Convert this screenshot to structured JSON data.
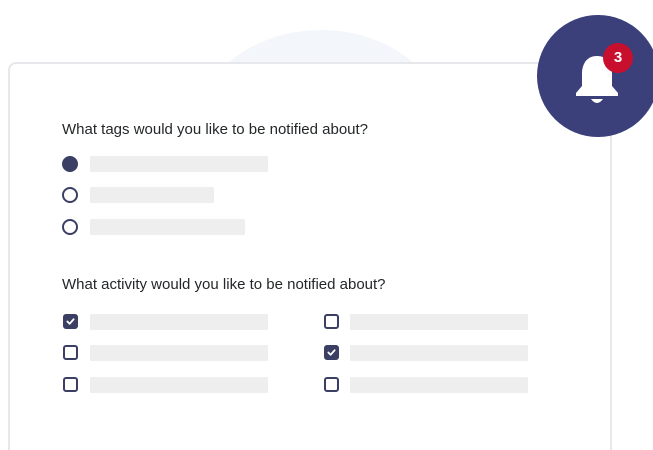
{
  "notifications": {
    "badge_count": "3",
    "icon": "bell-icon"
  },
  "tags_section": {
    "question": "What tags would you like to be notified about?",
    "options": [
      {
        "selected": true,
        "label": ""
      },
      {
        "selected": false,
        "label": ""
      },
      {
        "selected": false,
        "label": ""
      }
    ]
  },
  "activity_section": {
    "question": "What activity would you like to be notified about?",
    "options": [
      {
        "checked": true,
        "label": ""
      },
      {
        "checked": false,
        "label": ""
      },
      {
        "checked": false,
        "label": ""
      },
      {
        "checked": false,
        "label": ""
      },
      {
        "checked": true,
        "label": ""
      },
      {
        "checked": false,
        "label": ""
      }
    ]
  },
  "colors": {
    "accent": "#3b3f63",
    "bell_background": "#3b3f7a",
    "badge": "#c8102e",
    "placeholder_bar": "#eeeeee"
  }
}
